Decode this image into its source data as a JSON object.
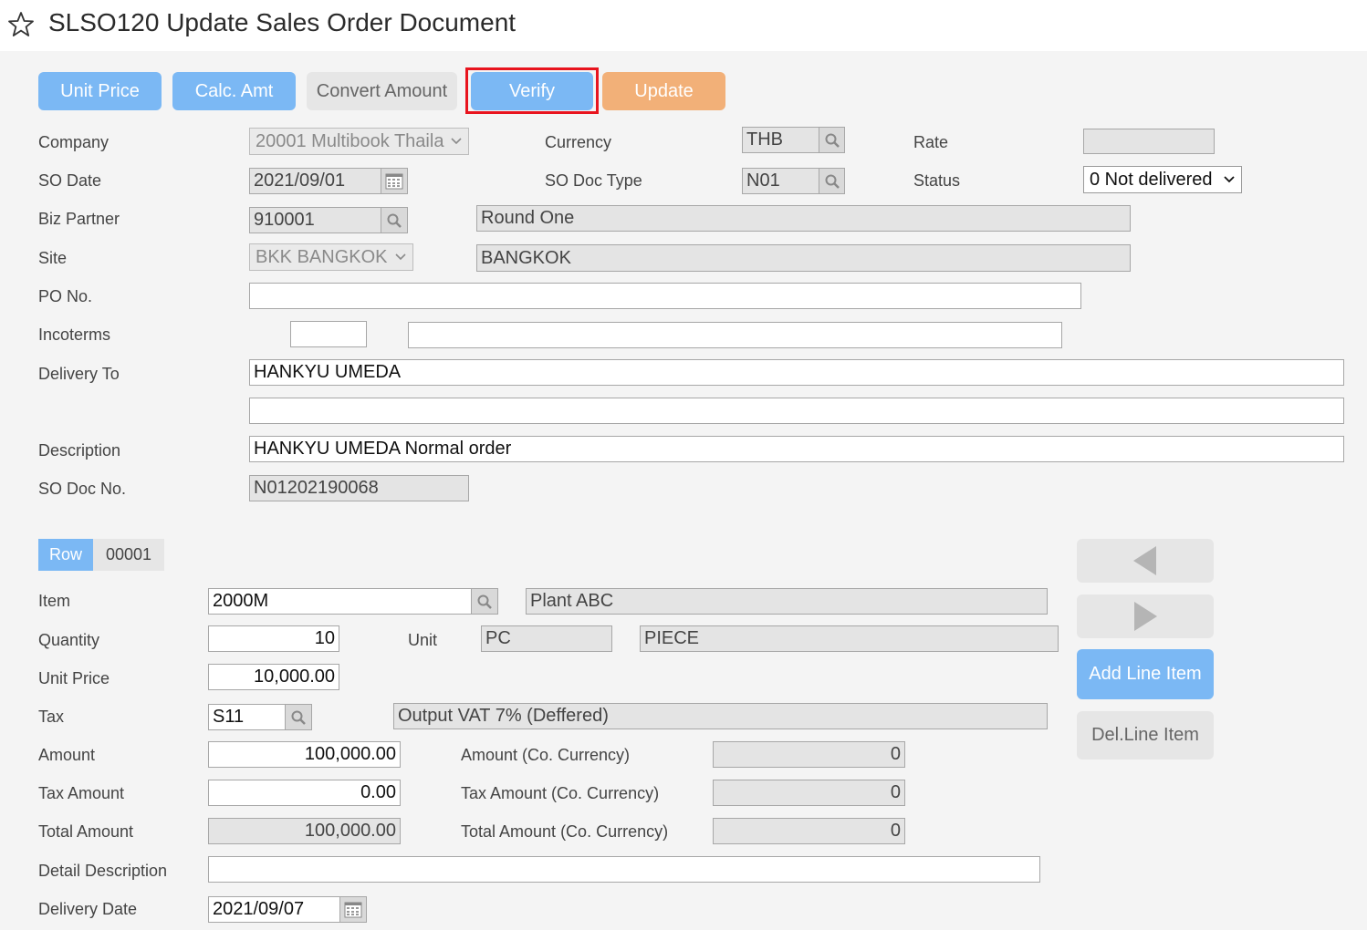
{
  "title": "SLSO120 Update Sales Order Document",
  "toolbar": {
    "unit_price": "Unit Price",
    "calc_amt": "Calc. Amt",
    "convert_amount": "Convert Amount",
    "verify": "Verify",
    "update": "Update"
  },
  "header": {
    "company_label": "Company",
    "company_value": "20001 Multibook Thaila",
    "currency_label": "Currency",
    "currency_value": "THB",
    "rate_label": "Rate",
    "rate_value": "",
    "so_date_label": "SO Date",
    "so_date_value": "2021/09/01",
    "so_doc_type_label": "SO Doc Type",
    "so_doc_type_value": "N01",
    "status_label": "Status",
    "status_value": "0 Not delivered",
    "biz_partner_label": "Biz Partner",
    "biz_partner_value": "910001",
    "biz_partner_name": "Round One",
    "site_label": "Site",
    "site_value": "BKK BANGKOK",
    "site_name": "BANGKOK",
    "po_no_label": "PO No.",
    "po_no_value": "",
    "incoterms_label": "Incoterms",
    "incoterms_code": "",
    "incoterms_desc": "",
    "delivery_to_label": "Delivery To",
    "delivery_to_line1": "HANKYU UMEDA",
    "delivery_to_line2": "",
    "description_label": "Description",
    "description_value": "HANKYU UMEDA Normal order",
    "so_doc_no_label": "SO Doc No.",
    "so_doc_no_value": "N01202190068"
  },
  "line": {
    "row_label": "Row",
    "row_number": "00001",
    "item_label": "Item",
    "item_value": "2000M",
    "item_name": "Plant ABC",
    "quantity_label": "Quantity",
    "quantity_value": "10",
    "unit_label": "Unit",
    "unit_code": "PC",
    "unit_name": "PIECE",
    "unit_price_label": "Unit Price",
    "unit_price_value": "10,000.00",
    "tax_label": "Tax",
    "tax_code": "S11",
    "tax_name": "Output VAT 7% (Deffered)",
    "amount_label": "Amount",
    "amount_value": "100,000.00",
    "amount_co_label": "Amount (Co. Currency)",
    "amount_co_value": "0",
    "tax_amount_label": "Tax Amount",
    "tax_amount_value": "0.00",
    "tax_amount_co_label": "Tax Amount (Co. Currency)",
    "tax_amount_co_value": "0",
    "total_amount_label": "Total Amount",
    "total_amount_value": "100,000.00",
    "total_amount_co_label": "Total Amount (Co. Currency)",
    "total_amount_co_value": "0",
    "detail_desc_label": "Detail Description",
    "detail_desc_value": "",
    "delivery_date_label": "Delivery Date",
    "delivery_date_value": "2021/09/07"
  },
  "side": {
    "add_line": "Add Line Item",
    "del_line": "Del.Line Item"
  },
  "icons": {
    "favorite": "star-icon",
    "lookup": "magnifier-icon",
    "calendar": "calendar-icon",
    "dropdown": "chevron-down-icon",
    "prev": "triangle-left-icon",
    "next": "triangle-right-icon"
  },
  "colors": {
    "primary_button": "#7bb8f4",
    "secondary_button": "#e6e6e6",
    "update_button": "#f2b078",
    "highlight_frame": "#e8141e"
  }
}
